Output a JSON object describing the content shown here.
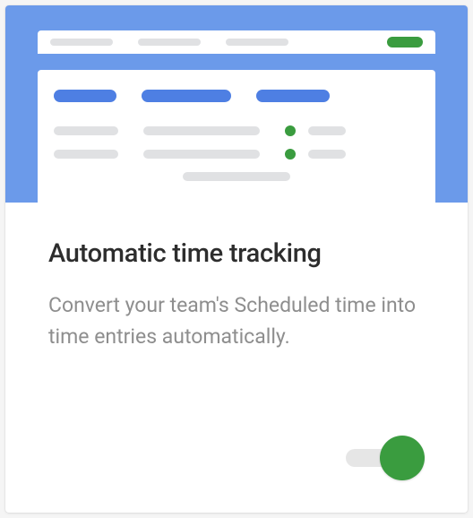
{
  "card": {
    "title": "Automatic time tracking",
    "description": "Convert your team's Scheduled time into time entries automatically.",
    "toggle_on": true
  }
}
